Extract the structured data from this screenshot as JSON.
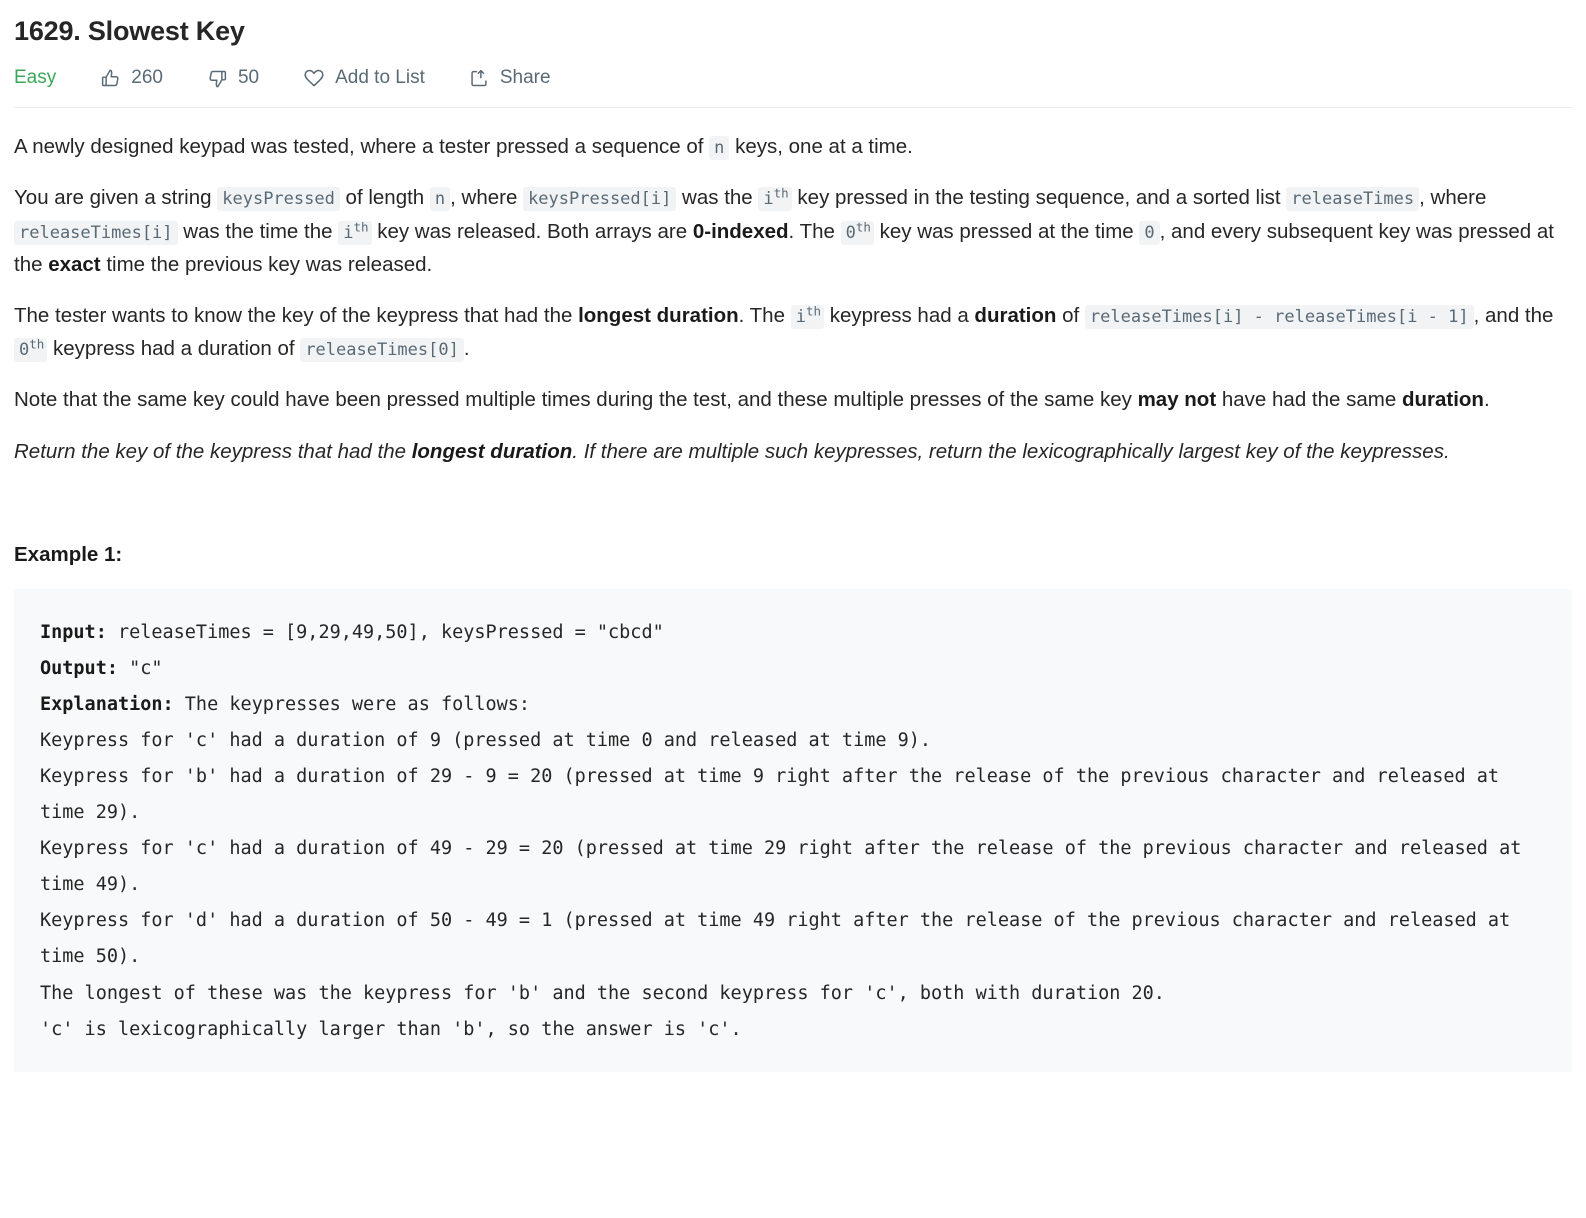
{
  "problem": {
    "title": "1629. Slowest Key",
    "difficulty": "Easy",
    "likes": "260",
    "dislikes": "50",
    "add_to_list_label": "Add to List",
    "share_label": "Share"
  },
  "description": {
    "p1": {
      "t1": "A newly designed keypad was tested, where a tester pressed a sequence of ",
      "c1": "n",
      "t2": " keys, one at a time."
    },
    "p2": {
      "t1": "You are given a string ",
      "c1": "keysPressed",
      "t2": " of length ",
      "c2": "n",
      "t3": ", where ",
      "c3": "keysPressed[i]",
      "t4": " was the ",
      "c4": "i",
      "c4sup": "th",
      "t5": " key pressed in the testing sequence, and a sorted list ",
      "c5": "releaseTimes",
      "t6": ", where ",
      "c6": "releaseTimes[i]",
      "t7": " was the time the ",
      "c7": "i",
      "c7sup": "th",
      "t8": " key was released. Both arrays are ",
      "b1": "0-indexed",
      "t9": ". The ",
      "c8": "0",
      "c8sup": "th",
      "t10": " key was pressed at the time ",
      "c9": "0",
      "t11": ", and every subsequent key was pressed at the ",
      "b2": "exact",
      "t12": " time the previous key was released."
    },
    "p3": {
      "t1": "The tester wants to know the key of the keypress that had the ",
      "b1": "longest duration",
      "t2": ". The ",
      "c1": "i",
      "c1sup": "th",
      "t3": " keypress had a ",
      "b2": "duration",
      "t4": " of ",
      "c2": "releaseTimes[i] - releaseTimes[i - 1]",
      "t5": ", and the ",
      "c3": "0",
      "c3sup": "th",
      "t6": " keypress had a duration of ",
      "c4": "releaseTimes[0]",
      "t7": "."
    },
    "p4": {
      "t1": "Note that the same key could have been pressed multiple times during the test, and these multiple presses of the same key ",
      "b1": "may not",
      "t2": " have had the same ",
      "b2": "duration",
      "t3": "."
    },
    "p5": {
      "t1": "Return the key of the keypress that had the ",
      "b1": "longest duration",
      "t2": ". If there are multiple such keypresses, return the lexicographically largest key of the keypresses."
    }
  },
  "example": {
    "heading": "Example 1:",
    "input_label": "Input:",
    "input_value": " releaseTimes = [9,29,49,50], keysPressed = \"cbcd\"",
    "output_label": "Output:",
    "output_value": " \"c\"",
    "explanation_label": "Explanation:",
    "explanation_value": " The keypresses were as follows:",
    "lines": [
      "Keypress for 'c' had a duration of 9 (pressed at time 0 and released at time 9).",
      "Keypress for 'b' had a duration of 29 - 9 = 20 (pressed at time 9 right after the release of the previous character and released at time 29).",
      "Keypress for 'c' had a duration of 49 - 29 = 20 (pressed at time 29 right after the release of the previous character and released at time 49).",
      "Keypress for 'd' had a duration of 50 - 49 = 1 (pressed at time 49 right after the release of the previous character and released at time 50).",
      "The longest of these was the keypress for 'b' and the second keypress for 'c', both with duration 20.",
      "'c' is lexicographically larger than 'b', so the answer is 'c'."
    ]
  },
  "icons": {
    "thumbs_up": "thumbs-up-icon",
    "thumbs_down": "thumbs-down-icon",
    "heart": "heart-icon",
    "share": "share-icon"
  },
  "colors": {
    "easy": "#3aa757",
    "meta_text": "#596a77",
    "code_bg": "#f7f9fa",
    "inline_code_bg": "#f2f3f4",
    "divider": "#e8ebee"
  }
}
